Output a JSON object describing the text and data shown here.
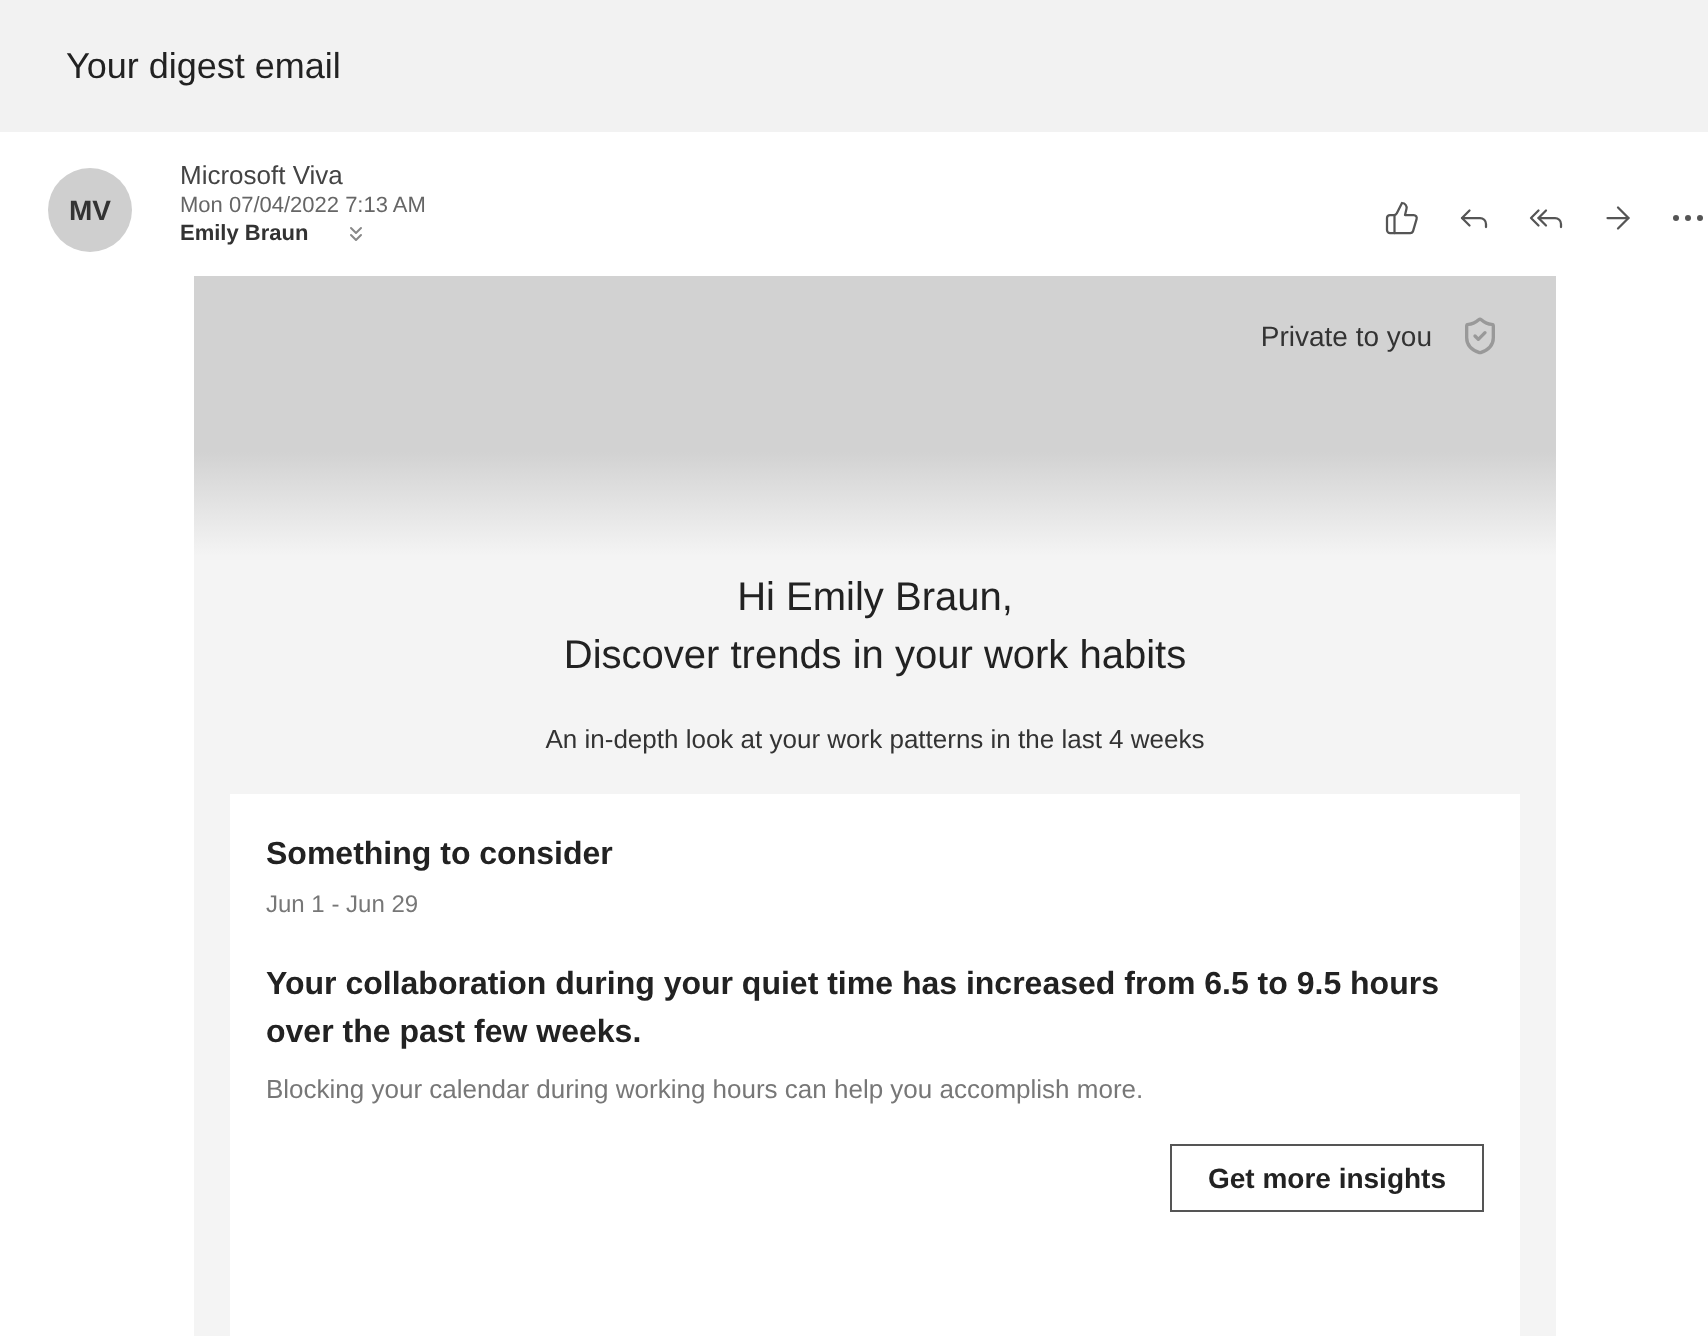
{
  "page_title": "Your digest email",
  "message": {
    "avatar_initials": "MV",
    "sender": "Microsoft Viva",
    "date": "Mon 07/04/2022 7:13 AM",
    "recipient": "Emily Braun"
  },
  "actions": [
    {
      "kind": "like"
    },
    {
      "kind": "reply"
    },
    {
      "kind": "reply_all"
    },
    {
      "kind": "forward"
    },
    {
      "kind": "more"
    }
  ],
  "email": {
    "privacy_label": "Private to you",
    "greeting": "Hi Emily Braun,",
    "headline": "Discover trends in your work habits",
    "subtitle": "An in-depth look at your work patterns in the last 4 weeks",
    "insight": {
      "title": "Something to consider",
      "date_range": "Jun 1 - Jun 29",
      "statement": "Your collaboration during your quiet time has increased from 6.5 to 9.5 hours over the past few weeks.",
      "tip": "Blocking your calendar during working hours can help you accomplish more.",
      "button": "Get more insights"
    }
  }
}
